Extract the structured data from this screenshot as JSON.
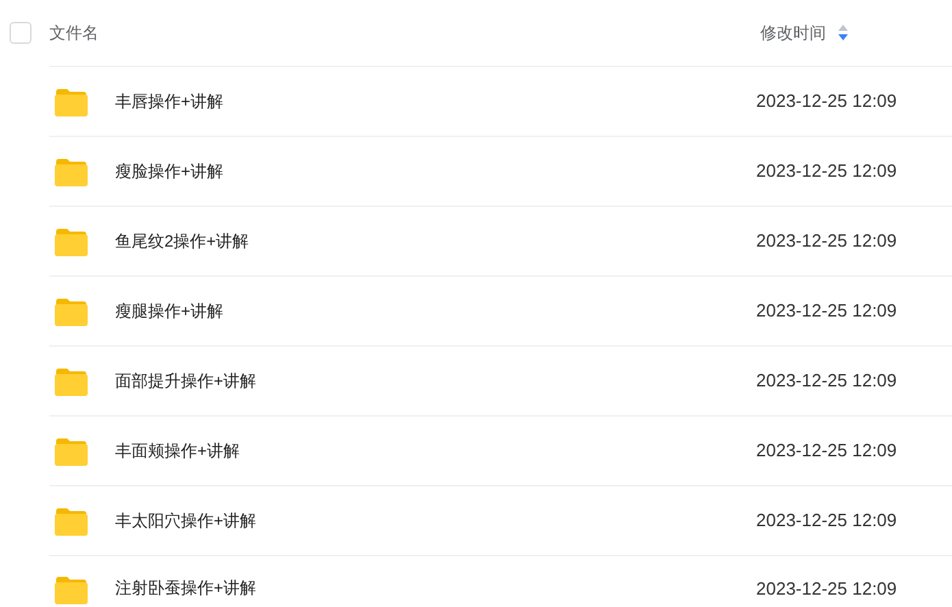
{
  "header": {
    "select_all": {
      "checked": false
    },
    "name_column": "文件名",
    "time_column": "修改时间",
    "sorted_descending": true
  },
  "rows": [
    {
      "name": "丰唇操作+讲解",
      "modified": "2023-12-25 12:09"
    },
    {
      "name": "瘦脸操作+讲解",
      "modified": "2023-12-25 12:09"
    },
    {
      "name": "鱼尾纹2操作+讲解",
      "modified": "2023-12-25 12:09"
    },
    {
      "name": "瘦腿操作+讲解",
      "modified": "2023-12-25 12:09"
    },
    {
      "name": "面部提升操作+讲解",
      "modified": "2023-12-25 12:09"
    },
    {
      "name": "丰面颊操作+讲解",
      "modified": "2023-12-25 12:09"
    },
    {
      "name": "丰太阳穴操作+讲解",
      "modified": "2023-12-25 12:09"
    },
    {
      "name": "注射卧蚕操作+讲解",
      "modified": "2023-12-25 12:09"
    }
  ]
}
